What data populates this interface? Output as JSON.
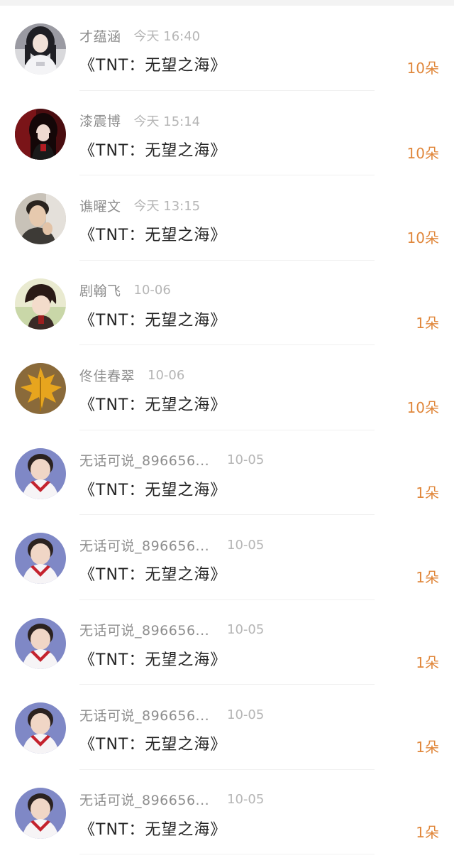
{
  "colors": {
    "count_accent": "#e0873b",
    "name_text": "#8e8e8e",
    "time_text": "#b5b5b5",
    "title_text": "#222222"
  },
  "items": [
    {
      "name": "才蕴涵",
      "time": "今天 16:40",
      "title": "《TNT：无望之海》",
      "count": "10朵",
      "avatar": "girl-photo-avatar"
    },
    {
      "name": "漆震博",
      "time": "今天 15:14",
      "title": "《TNT：无望之海》",
      "count": "10朵",
      "avatar": "anime-dark-avatar"
    },
    {
      "name": "谯曜文",
      "time": "今天 13:15",
      "title": "《TNT：无望之海》",
      "count": "10朵",
      "avatar": "boy-photo-avatar"
    },
    {
      "name": "剧翰飞",
      "time": "10-06",
      "title": "《TNT：无望之海》",
      "count": "1朵",
      "avatar": "anime-boy-avatar"
    },
    {
      "name": "佟佳春翠",
      "time": "10-06",
      "title": "《TNT：无望之海》",
      "count": "10朵",
      "avatar": "maple-leaf-avatar"
    },
    {
      "name": "无话可说_896656...",
      "time": "10-05",
      "title": "《TNT：无望之海》",
      "count": "1朵",
      "avatar": "child-sailor-avatar"
    },
    {
      "name": "无话可说_896656...",
      "time": "10-05",
      "title": "《TNT：无望之海》",
      "count": "1朵",
      "avatar": "child-sailor-avatar"
    },
    {
      "name": "无话可说_896656...",
      "time": "10-05",
      "title": "《TNT：无望之海》",
      "count": "1朵",
      "avatar": "child-sailor-avatar"
    },
    {
      "name": "无话可说_896656...",
      "time": "10-05",
      "title": "《TNT：无望之海》",
      "count": "1朵",
      "avatar": "child-sailor-avatar"
    },
    {
      "name": "无话可说_896656...",
      "time": "10-05",
      "title": "《TNT：无望之海》",
      "count": "1朵",
      "avatar": "child-sailor-avatar"
    }
  ]
}
